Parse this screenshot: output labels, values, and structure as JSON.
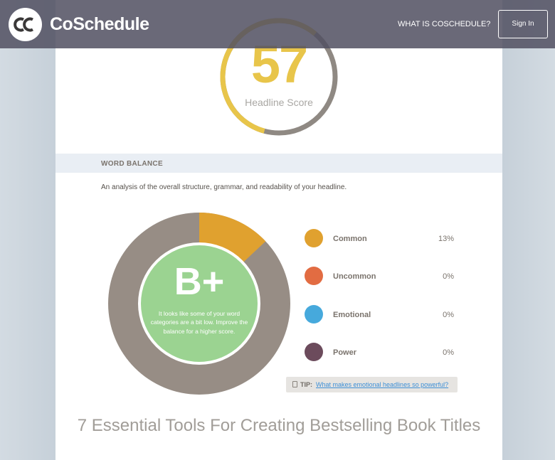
{
  "header": {
    "logo_text": "CoSchedule",
    "nav_link": "WHAT IS COSCHEDULE?",
    "signin_label": "Sign In"
  },
  "score": {
    "value": 57,
    "label": "Headline Score",
    "colors": {
      "filled": "#e8c54a",
      "remaining": "#8f8983"
    }
  },
  "word_balance": {
    "title": "WORD BALANCE",
    "description": "An analysis of the overall structure, grammar, and readability of your headline.",
    "grade": "B+",
    "grade_message": "It looks like some of your word categories are a bit low. Improve the balance for a higher score.",
    "categories": [
      {
        "label": "Common",
        "value": "13%",
        "percent": 13,
        "color": "#e0a12f"
      },
      {
        "label": "Uncommon",
        "value": "0%",
        "percent": 0,
        "color": "#e26c42"
      },
      {
        "label": "Emotional",
        "value": "0%",
        "percent": 0,
        "color": "#46a9dc"
      },
      {
        "label": "Power",
        "value": "0%",
        "percent": 0,
        "color": "#6c4b5c"
      }
    ],
    "donut_base_color": "#978d85",
    "center_color": "#9bd391"
  },
  "tip": {
    "prefix": "TIP:",
    "link_text": "What makes emotional headlines so powerful?"
  },
  "headline_text": "7 Essential Tools For Creating Bestselling Book Titles"
}
